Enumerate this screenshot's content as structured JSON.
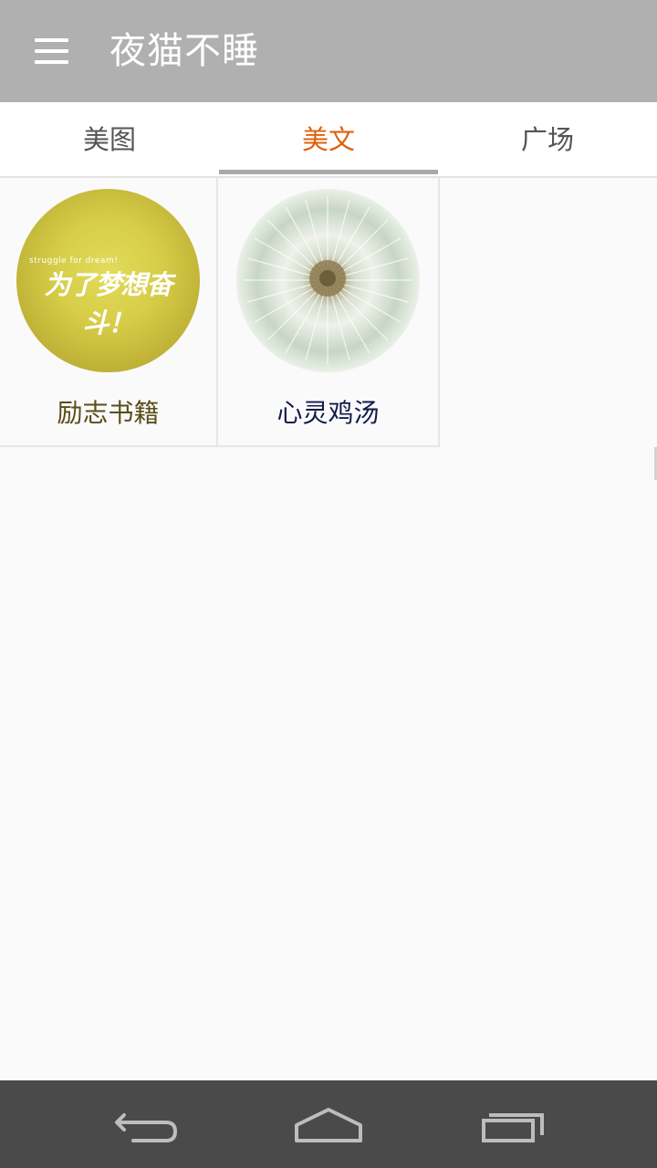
{
  "app_bar": {
    "title": "夜猫不睡",
    "menu_icon": "hamburger-menu-icon",
    "background": "#b0b0b0"
  },
  "tabs": [
    {
      "label": "美图",
      "active": false
    },
    {
      "label": "美文",
      "active": true
    },
    {
      "label": "广场",
      "active": false
    }
  ],
  "grid": [
    {
      "label": "励志书籍",
      "label_color": "#5a4d1a",
      "image": "motivation-badge-image",
      "image_text": "为了梦想奋斗！",
      "image_subtext": "struggle for dream!"
    },
    {
      "label": "心灵鸡汤",
      "label_color": "#141a4a",
      "image": "dandelion-image"
    }
  ],
  "nav_bar": {
    "back_icon": "back-icon",
    "home_icon": "home-icon",
    "recents_icon": "recent-apps-icon"
  },
  "colors": {
    "accent": "#e0610e",
    "nav_bar": "#4a4a4a"
  }
}
